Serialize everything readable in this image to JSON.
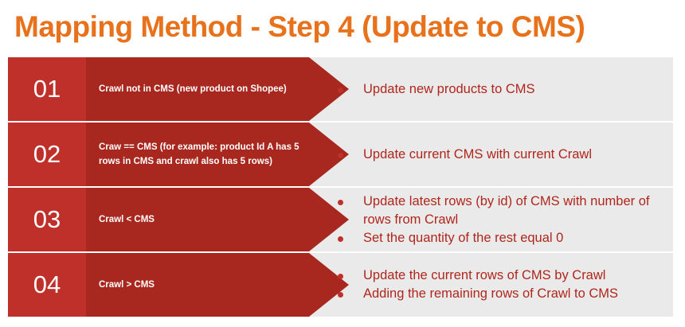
{
  "title": "Mapping Method - Step 4 (Update to CMS)",
  "colors": {
    "title": "#e8711c",
    "number_box": "#c0302a",
    "arrow": "#a8281f",
    "bullet_text": "#b0261c",
    "bullet_dot": "#c0302a",
    "row_background": "#eaeaea"
  },
  "rows": [
    {
      "number": "01",
      "condition": "Crawl not in CMS (new product on Shopee)",
      "actions": [
        "Update new products to CMS"
      ]
    },
    {
      "number": "02",
      "condition": "Craw == CMS (for example: product Id A has 5 rows in CMS and crawl also has 5 rows)",
      "actions": [
        "Update current CMS with current Crawl"
      ]
    },
    {
      "number": "03",
      "condition": "Crawl < CMS",
      "actions": [
        "Update latest rows (by id) of CMS with number of rows from Crawl",
        "Set the quantity of the rest equal 0"
      ]
    },
    {
      "number": "04",
      "condition": "Crawl > CMS",
      "actions": [
        "Update the current rows of CMS by Crawl",
        "Adding the remaining rows of Crawl to CMS"
      ]
    }
  ]
}
